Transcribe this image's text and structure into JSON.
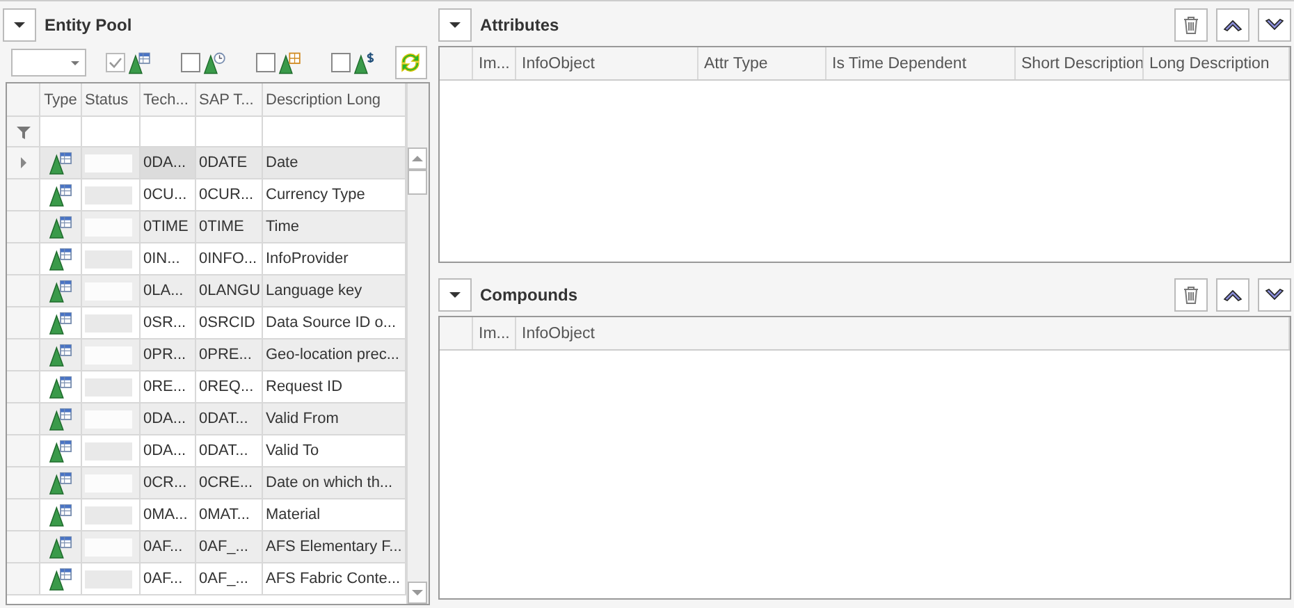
{
  "entity_pool": {
    "title": "Entity Pool",
    "filters": [
      {
        "checked": true,
        "disabled": true
      },
      {
        "checked": false,
        "disabled": false
      },
      {
        "checked": false,
        "disabled": false
      },
      {
        "checked": false,
        "disabled": false
      }
    ],
    "columns": [
      "Type",
      "Status",
      "Tech...",
      "SAP T...",
      "Description Long"
    ],
    "rows": [
      {
        "tech": "0DA...",
        "sap": "0DATE",
        "description": "Date",
        "selected": true
      },
      {
        "tech": "0CU...",
        "sap": "0CUR...",
        "description": "Currency Type",
        "selected": false
      },
      {
        "tech": "0TIME",
        "sap": "0TIME",
        "description": "Time",
        "selected": false
      },
      {
        "tech": "0IN...",
        "sap": "0INFO...",
        "description": "InfoProvider",
        "selected": false
      },
      {
        "tech": "0LA...",
        "sap": "0LANGU",
        "description": "Language key",
        "selected": false
      },
      {
        "tech": "0SR...",
        "sap": "0SRCID",
        "description": "Data Source ID o...",
        "selected": false
      },
      {
        "tech": "0PR...",
        "sap": "0PRE...",
        "description": "Geo-location prec...",
        "selected": false
      },
      {
        "tech": "0RE...",
        "sap": "0REQ...",
        "description": "Request ID",
        "selected": false
      },
      {
        "tech": "0DA...",
        "sap": "0DAT...",
        "description": "Valid From",
        "selected": false
      },
      {
        "tech": "0DA...",
        "sap": "0DAT...",
        "description": "Valid To",
        "selected": false
      },
      {
        "tech": "0CR...",
        "sap": "0CRE...",
        "description": "Date on which th...",
        "selected": false
      },
      {
        "tech": "0MA...",
        "sap": "0MAT...",
        "description": "Material",
        "selected": false
      },
      {
        "tech": "0AF...",
        "sap": "0AF_...",
        "description": "AFS Elementary F...",
        "selected": false
      },
      {
        "tech": "0AF...",
        "sap": "0AF_...",
        "description": "AFS Fabric Conte...",
        "selected": false
      }
    ]
  },
  "attributes": {
    "title": "Attributes",
    "columns": [
      "Im...",
      "InfoObject",
      "Attr Type",
      "Is Time Dependent",
      "Short Description",
      "Long Description"
    ]
  },
  "compounds": {
    "title": "Compounds",
    "columns": [
      "Im...",
      "InfoObject"
    ]
  }
}
